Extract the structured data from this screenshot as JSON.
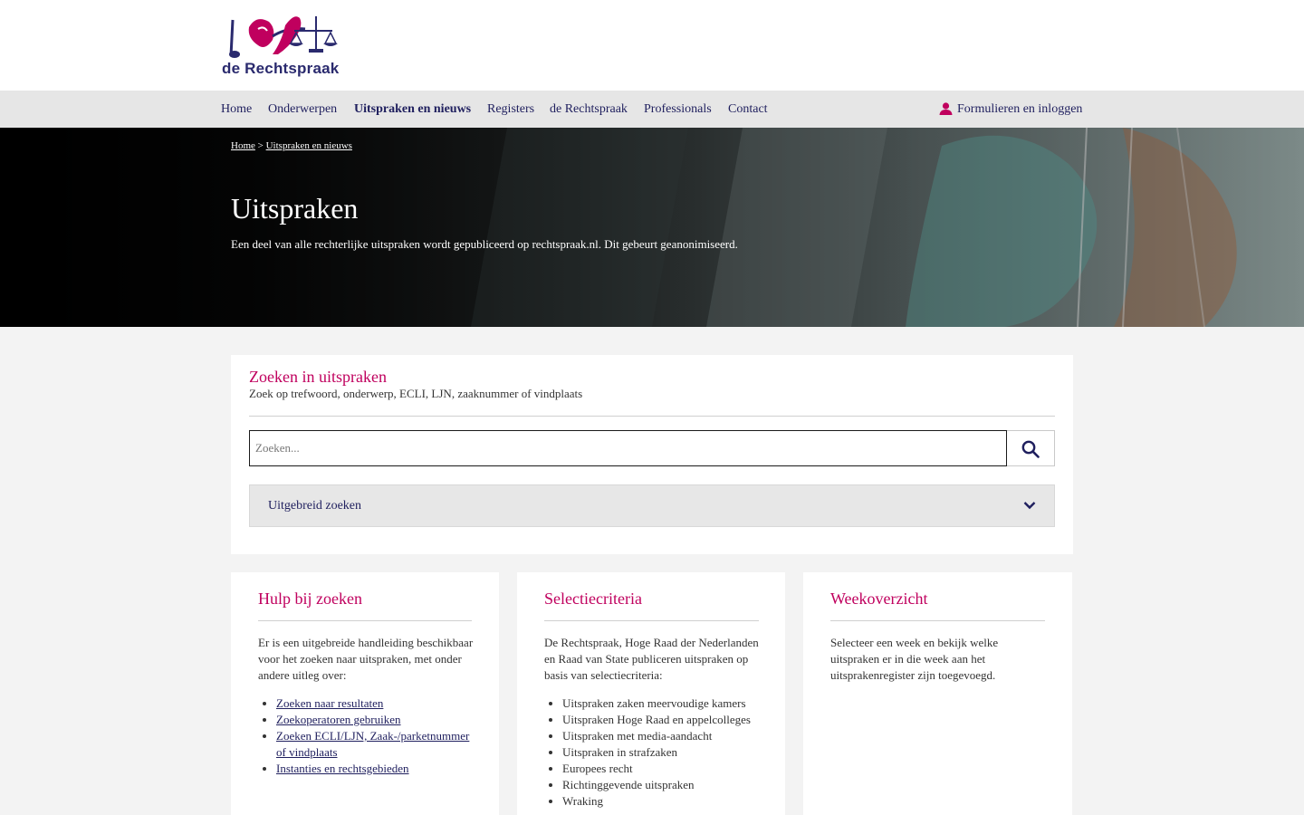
{
  "logo": {
    "text": "de Rechtspraak"
  },
  "nav": {
    "items": [
      {
        "label": "Home"
      },
      {
        "label": "Onderwerpen"
      },
      {
        "label": "Uitspraken en nieuws"
      },
      {
        "label": "Registers"
      },
      {
        "label": "de Rechtspraak"
      },
      {
        "label": "Professionals"
      },
      {
        "label": "Contact"
      }
    ],
    "login_label": "Formulieren en inloggen"
  },
  "breadcrumb": {
    "home": "Home",
    "separator": ">",
    "current": "Uitspraken en nieuws"
  },
  "hero": {
    "title": "Uitspraken",
    "subtitle": "Een deel van alle rechterlijke uitspraken wordt gepubliceerd op rechtspraak.nl. Dit gebeurt geanonimiseerd."
  },
  "search": {
    "title": "Zoeken in uitspraken",
    "subtitle": "Zoek op trefwoord, onderwerp, ECLI, LJN, zaaknummer of vindplaats",
    "placeholder": "Zoeken...",
    "value": "",
    "advanced_label": "Uitgebreid zoeken"
  },
  "cards": {
    "help": {
      "title": "Hulp bij zoeken",
      "text": "Er is een uitgebreide handleiding beschikbaar voor het zoeken naar uitspraken, met onder andere uitleg over:",
      "links": [
        "Zoeken naar resultaten",
        "Zoekoperatoren gebruiken",
        "Zoeken ECLI/LJN, Zaak-/parketnummer of vindplaats",
        "Instanties en rechtsgebieden"
      ]
    },
    "criteria": {
      "title": "Selectiecriteria",
      "text": "De Rechtspraak, Hoge Raad der Nederlanden en Raad van State publiceren uitspraken op basis van selectiecriteria:",
      "items": [
        "Uitspraken zaken meervoudige kamers",
        "Uitspraken Hoge Raad en appelcolleges",
        "Uitspraken met media-aandacht",
        "Uitspraken in strafzaken",
        "Europees recht",
        "Richtinggevende uitspraken",
        "Wraking"
      ]
    },
    "week": {
      "title": "Weekoverzicht",
      "text": "Selecteer een week en bekijk welke uitspraken er in die week aan het uitsprakenregister zijn toegevoegd."
    }
  },
  "colors": {
    "accent": "#c0005e",
    "navy": "#1f1f5e",
    "navbar": "#e6e6e6",
    "page_bg": "#f3f3f3"
  },
  "icons": {
    "login": "user-icon",
    "search": "search-icon",
    "advanced": "chevron-down-icon"
  }
}
